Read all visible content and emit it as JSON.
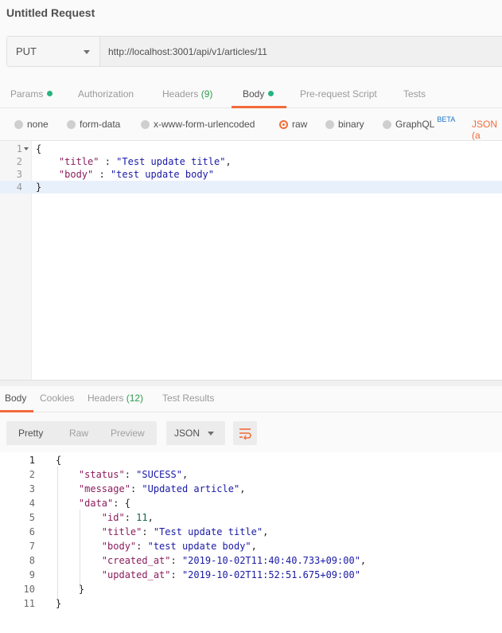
{
  "window": {
    "title": "Untitled Request"
  },
  "request": {
    "method": "PUT",
    "url": "http://localhost:3001/api/v1/articles/11"
  },
  "request_tabs": [
    {
      "label": "Params",
      "indicator": "dot"
    },
    {
      "label": "Authorization"
    },
    {
      "label": "Headers",
      "count": "(9)"
    },
    {
      "label": "Body",
      "indicator": "dot",
      "active": true
    },
    {
      "label": "Pre-request Script"
    },
    {
      "label": "Tests"
    }
  ],
  "body_types": {
    "none": "none",
    "form_data": "form-data",
    "urlencoded": "x-www-form-urlencoded",
    "raw": "raw",
    "binary": "binary",
    "graphql": "GraphQL",
    "graphql_badge": "BETA",
    "format": "JSON (a"
  },
  "editor": {
    "lines": [
      {
        "n": "1",
        "tokens": [
          [
            "p",
            "{"
          ]
        ]
      },
      {
        "n": "2",
        "tokens": [
          [
            "p",
            "    "
          ],
          [
            "k",
            "\"title\""
          ],
          [
            "p",
            " : "
          ],
          [
            "s",
            "\"Test update title\""
          ],
          [
            "p",
            ","
          ]
        ]
      },
      {
        "n": "3",
        "tokens": [
          [
            "p",
            "    "
          ],
          [
            "k",
            "\"body\""
          ],
          [
            "p",
            " : "
          ],
          [
            "s",
            "\"test update body\""
          ]
        ]
      },
      {
        "n": "4",
        "tokens": [
          [
            "p",
            "}"
          ]
        ]
      }
    ]
  },
  "response_tabs": {
    "body": "Body",
    "cookies": "Cookies",
    "headers": "Headers",
    "headers_count": "(12)",
    "test_results": "Test Results"
  },
  "view_modes": {
    "pretty": "Pretty",
    "raw": "Raw",
    "preview": "Preview",
    "format": "JSON"
  },
  "response": {
    "lines": [
      {
        "n": "1",
        "tokens": [
          [
            "p",
            "{"
          ]
        ]
      },
      {
        "n": "2",
        "tokens": [
          [
            "p",
            "    "
          ],
          [
            "k",
            "\"status\""
          ],
          [
            "p",
            ": "
          ],
          [
            "s",
            "\"SUCESS\""
          ],
          [
            "p",
            ","
          ]
        ]
      },
      {
        "n": "3",
        "tokens": [
          [
            "p",
            "    "
          ],
          [
            "k",
            "\"message\""
          ],
          [
            "p",
            ": "
          ],
          [
            "s",
            "\"Updated article\""
          ],
          [
            "p",
            ","
          ]
        ]
      },
      {
        "n": "4",
        "tokens": [
          [
            "p",
            "    "
          ],
          [
            "k",
            "\"data\""
          ],
          [
            "p",
            ": {"
          ]
        ]
      },
      {
        "n": "5",
        "tokens": [
          [
            "p",
            "        "
          ],
          [
            "k",
            "\"id\""
          ],
          [
            "p",
            ": "
          ],
          [
            "n",
            "11"
          ],
          [
            "p",
            ","
          ]
        ]
      },
      {
        "n": "6",
        "tokens": [
          [
            "p",
            "        "
          ],
          [
            "k",
            "\"title\""
          ],
          [
            "p",
            ": "
          ],
          [
            "s",
            "\"Test update title\""
          ],
          [
            "p",
            ","
          ]
        ]
      },
      {
        "n": "7",
        "tokens": [
          [
            "p",
            "        "
          ],
          [
            "k",
            "\"body\""
          ],
          [
            "p",
            ": "
          ],
          [
            "s",
            "\"test update body\""
          ],
          [
            "p",
            ","
          ]
        ]
      },
      {
        "n": "8",
        "tokens": [
          [
            "p",
            "        "
          ],
          [
            "k",
            "\"created_at\""
          ],
          [
            "p",
            ": "
          ],
          [
            "s",
            "\"2019-10-02T11:40:40.733+09:00\""
          ],
          [
            "p",
            ","
          ]
        ]
      },
      {
        "n": "9",
        "tokens": [
          [
            "p",
            "        "
          ],
          [
            "k",
            "\"updated_at\""
          ],
          [
            "p",
            ": "
          ],
          [
            "s",
            "\"2019-10-02T11:52:51.675+09:00\""
          ]
        ]
      },
      {
        "n": "10",
        "tokens": [
          [
            "p",
            "    }"
          ]
        ]
      },
      {
        "n": "11",
        "tokens": [
          [
            "p",
            "}"
          ]
        ]
      }
    ]
  }
}
